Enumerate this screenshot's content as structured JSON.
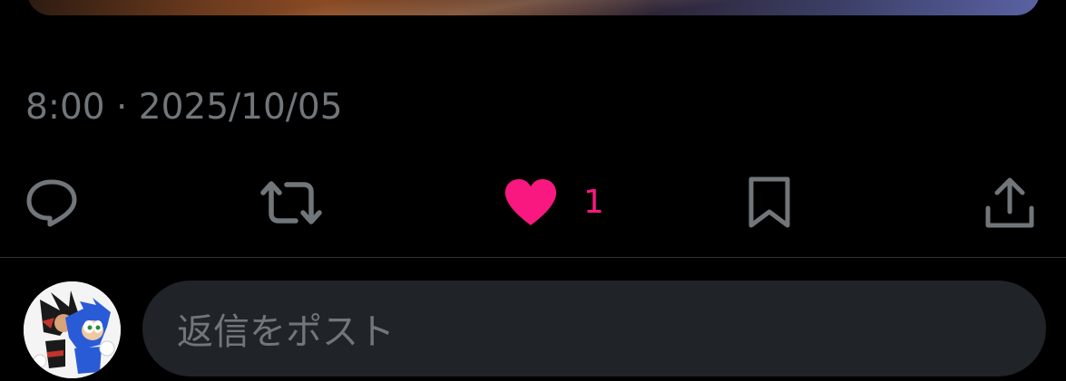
{
  "post": {
    "timestamp": "8:00 · 2025/10/05"
  },
  "actions": {
    "reply": {
      "icon": "reply-icon"
    },
    "repost": {
      "icon": "repost-icon"
    },
    "like": {
      "icon": "heart-icon",
      "count": "1",
      "liked": true
    },
    "bookmark": {
      "icon": "bookmark-icon"
    },
    "share": {
      "icon": "share-icon"
    }
  },
  "reply_composer": {
    "placeholder": "返信をポスト"
  },
  "colors": {
    "background": "#000000",
    "muted_text": "#71767b",
    "like_pink": "#f91880",
    "divider": "#2f3336",
    "input_background": "#202327"
  }
}
